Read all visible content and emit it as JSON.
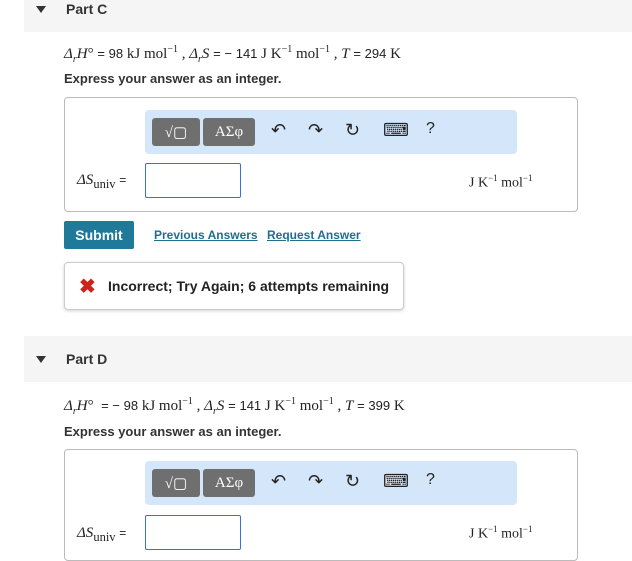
{
  "partC": {
    "title": "Part C",
    "given": {
      "dH_sym": "ΔrH°",
      "dH_eq": "=",
      "dH_val": "98",
      "dH_unit": "kJ mol",
      "dS_sym": "ΔrS",
      "dS_eq": "= −",
      "dS_val": "141",
      "dS_unit": "J K",
      "T_sym": "T",
      "T_eq": "=",
      "T_val": "294",
      "T_unit": "K"
    },
    "instruction": "Express your answer as an integer.",
    "answer_label": "ΔSuniv",
    "answer_value": "",
    "units": "J K⁻¹ mol⁻¹"
  },
  "toolbar": {
    "templates_label": "√▢",
    "symbols_label": "ΑΣφ",
    "undo": "↶",
    "redo": "↷",
    "reset": "↻",
    "keyboard": "⌨",
    "help": "?"
  },
  "actions": {
    "submit_label": "Submit",
    "prev_answers_label": "Previous Answers",
    "request_answer_label": "Request Answer"
  },
  "feedback": {
    "icon": "✖",
    "message": "Incorrect; Try Again; 6 attempts remaining"
  },
  "partD": {
    "title": "Part D",
    "given": {
      "dH_eq": "= −",
      "dH_val": "98",
      "dS_eq": "=",
      "dS_val": "141",
      "T_eq": "=",
      "T_val": "399"
    },
    "instruction": "Express your answer as an integer.",
    "answer_value": ""
  },
  "colors": {
    "accent": "#1e7a98",
    "toolbar_bg": "#d4e6f9",
    "error": "#d0221a",
    "header_bg": "#f5f5f5"
  }
}
